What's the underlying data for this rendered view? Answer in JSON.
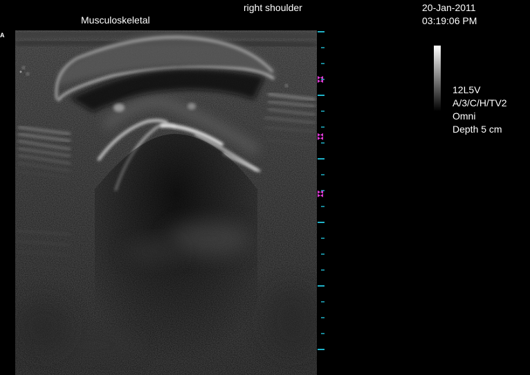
{
  "header": {
    "preset": "Musculoskeletal",
    "site": "right shoulder",
    "date": "20-Jan-2011",
    "time": "03:19:06 PM"
  },
  "orientation_marker": "A",
  "params": {
    "probe": "12L5V",
    "settings": "A/3/C/H/TV2",
    "mode": "Omni",
    "depth": "Depth 5 cm"
  },
  "depth_scale": {
    "depth_cm": 5,
    "focus_zones": 3
  },
  "colors": {
    "background": "#000000",
    "text": "#ffffff",
    "ruler_ticks": "#1fb3c9",
    "focus_markers": "#e03ad8"
  }
}
